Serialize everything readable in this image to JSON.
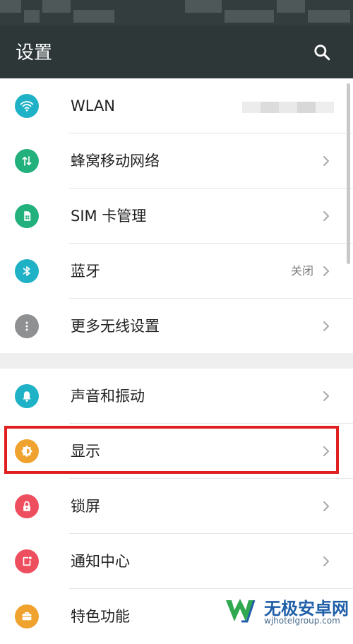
{
  "app_bar": {
    "title": "设置",
    "search_icon": "search-icon"
  },
  "colors": {
    "app_bar": "#2d3738",
    "wlan": "#1fb2c6",
    "cellular": "#22b07d",
    "sim": "#22b07d",
    "bluetooth": "#1fb2c6",
    "more": "#8e9091",
    "sound": "#1fb2c6",
    "display": "#f0a22e",
    "lockscreen": "#ee4f5f",
    "notification": "#ee4f5f",
    "features": "#f0a22e",
    "highlight": "#e02020"
  },
  "sections": [
    {
      "items": [
        {
          "label": "WLAN",
          "icon": "wifi-icon"
        },
        {
          "label": "蜂窝移动网络",
          "icon": "cellular-data-icon"
        },
        {
          "label": "SIM 卡管理",
          "icon": "sim-card-icon"
        },
        {
          "label": "蓝牙",
          "icon": "bluetooth-icon",
          "status": "关闭"
        },
        {
          "label": "更多无线设置",
          "icon": "more-dots-icon"
        }
      ]
    },
    {
      "items": [
        {
          "label": "声音和振动",
          "icon": "bell-icon"
        },
        {
          "label": "显示",
          "icon": "brightness-icon"
        },
        {
          "label": "锁屏",
          "icon": "lock-icon"
        },
        {
          "label": "通知中心",
          "icon": "notification-icon"
        },
        {
          "label": "特色功能",
          "icon": "briefcase-icon"
        }
      ]
    }
  ],
  "watermark": {
    "name": "无极安卓网",
    "url": "wjhotelgroup.com"
  }
}
